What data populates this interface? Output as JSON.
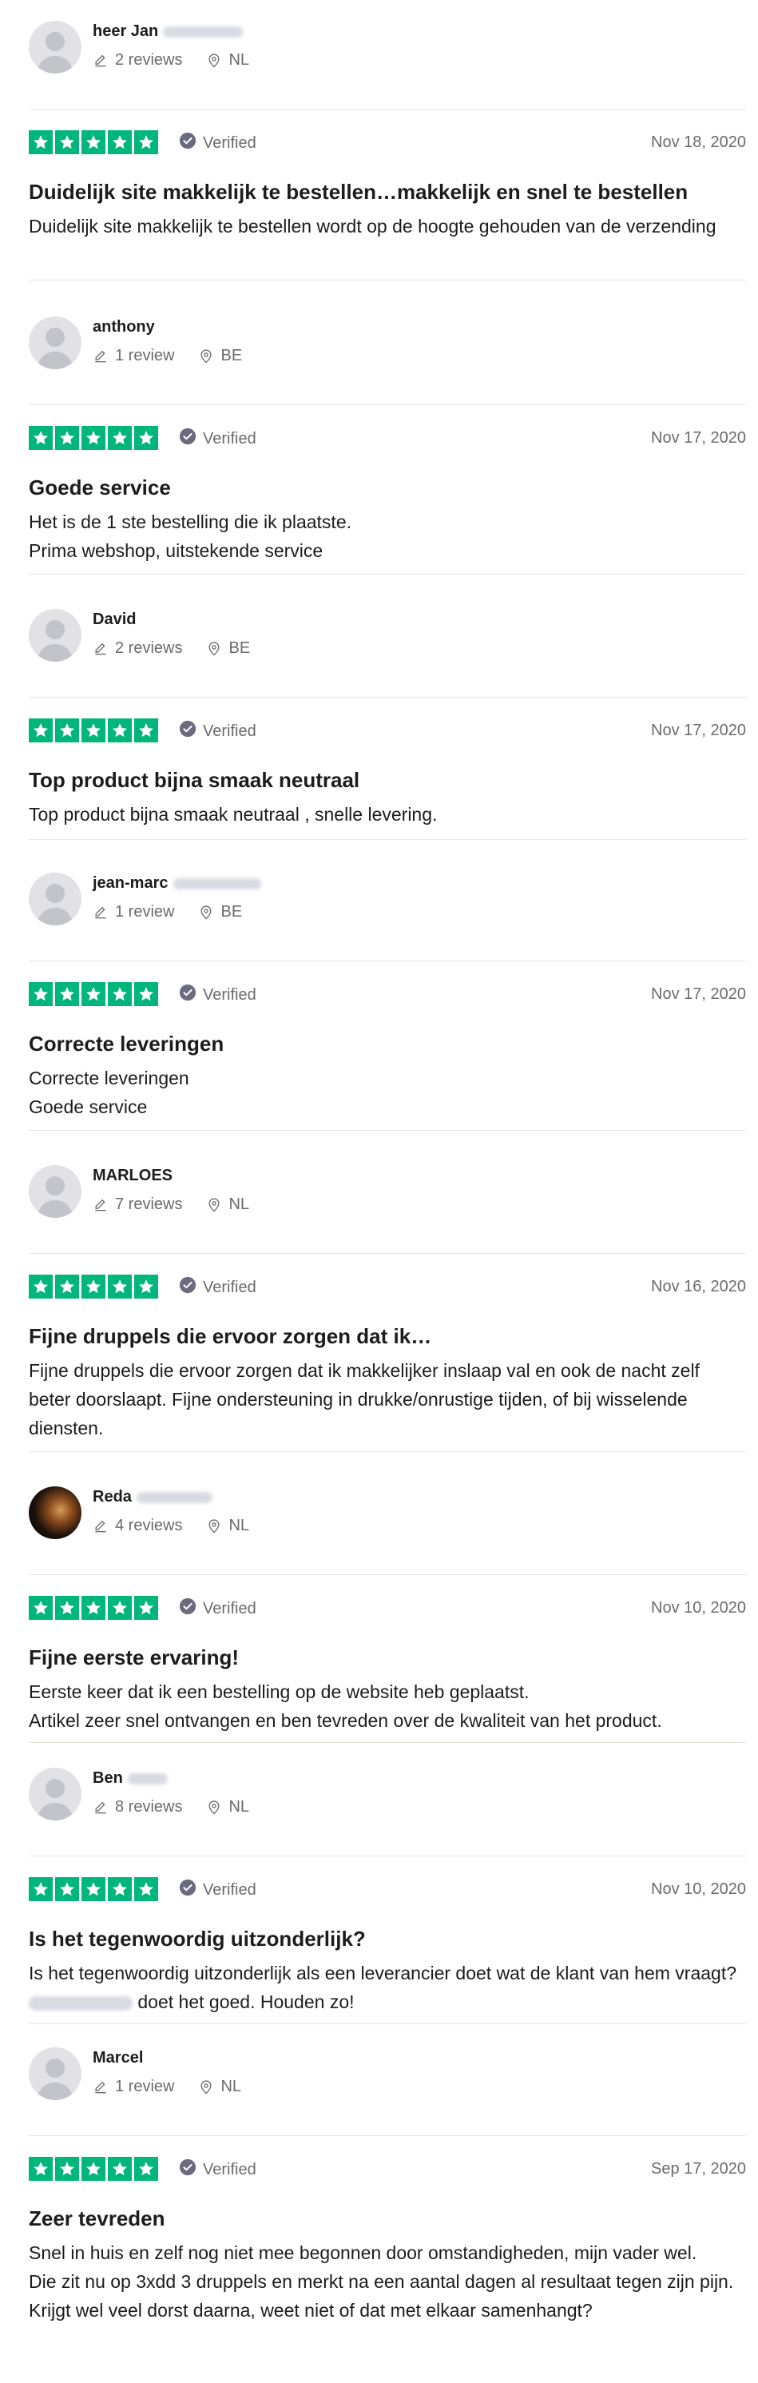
{
  "colors": {
    "star_green": "#00b67a",
    "muted": "#6b6b6b",
    "divider": "#e5e5dd"
  },
  "icons": {
    "review_count": "pencil-icon",
    "location": "location-pin-icon",
    "verified": "check-circle-icon",
    "rating": "star-icon"
  },
  "reviews": [
    {
      "name": "heer Jan",
      "review_count": "2 reviews",
      "country": "NL",
      "rating": 5,
      "verified_label": "Verified",
      "date": "Nov 18, 2020",
      "title": "Duidelijk site makkelijk te bestellen…makkelijk en snel te bestellen",
      "body": [
        "Duidelijk site makkelijk te bestellen wordt op de hoogte gehouden van de verzending"
      ]
    },
    {
      "name": "anthony",
      "review_count": "1 review",
      "country": "BE",
      "rating": 5,
      "verified_label": "Verified",
      "date": "Nov 17, 2020",
      "title": "Goede service",
      "body": [
        "Het is de 1 ste bestelling die ik plaatste.",
        "Prima webshop, uitstekende service"
      ]
    },
    {
      "name": "David",
      "review_count": "2 reviews",
      "country": "BE",
      "rating": 5,
      "verified_label": "Verified",
      "date": "Nov 17, 2020",
      "title": "Top product bijna smaak neutraal",
      "body": [
        "Top product bijna smaak neutraal , snelle levering."
      ]
    },
    {
      "name": "jean-marc",
      "review_count": "1 review",
      "country": "BE",
      "rating": 5,
      "verified_label": "Verified",
      "date": "Nov 17, 2020",
      "title": "Correcte leveringen",
      "body": [
        "Correcte leveringen",
        "Goede service"
      ]
    },
    {
      "name": "MARLOES",
      "review_count": "7 reviews",
      "country": "NL",
      "rating": 5,
      "verified_label": "Verified",
      "date": "Nov 16, 2020",
      "title": "Fijne druppels die ervoor zorgen dat ik…",
      "body": [
        "Fijne druppels die ervoor zorgen dat ik makkelijker inslaap val en ook de nacht zelf beter doorslaapt. Fijne ondersteuning in drukke/onrustige tijden, of bij wisselende diensten."
      ]
    },
    {
      "name": "Reda",
      "review_count": "4 reviews",
      "country": "NL",
      "rating": 5,
      "verified_label": "Verified",
      "date": "Nov 10, 2020",
      "title": "Fijne eerste ervaring!",
      "body": [
        "Eerste keer dat ik een bestelling op de website heb geplaatst.",
        "Artikel zeer snel ontvangen en ben tevreden over de kwaliteit van het product."
      ]
    },
    {
      "name": "Ben",
      "review_count": "8 reviews",
      "country": "NL",
      "rating": 5,
      "verified_label": "Verified",
      "date": "Nov 10, 2020",
      "title": "Is het tegenwoordig uitzonderlijk?",
      "body_prefix": "Is het tegenwoordig uitzonderlijk als een leverancier doet wat de klant van hem vraagt?",
      "body_suffix": "doet het goed. Houden zo!"
    },
    {
      "name": "Marcel",
      "review_count": "1 review",
      "country": "NL",
      "rating": 5,
      "verified_label": "Verified",
      "date": "Sep 17, 2020",
      "title": "Zeer tevreden",
      "body": [
        "Snel in huis en zelf nog niet mee begonnen door omstandigheden, mijn vader wel.",
        "Die zit nu op 3xdd 3 druppels en merkt na een aantal dagen al resultaat tegen zijn pijn.",
        "Krijgt wel veel dorst daarna, weet niet of dat met elkaar samenhangt?"
      ]
    }
  ]
}
